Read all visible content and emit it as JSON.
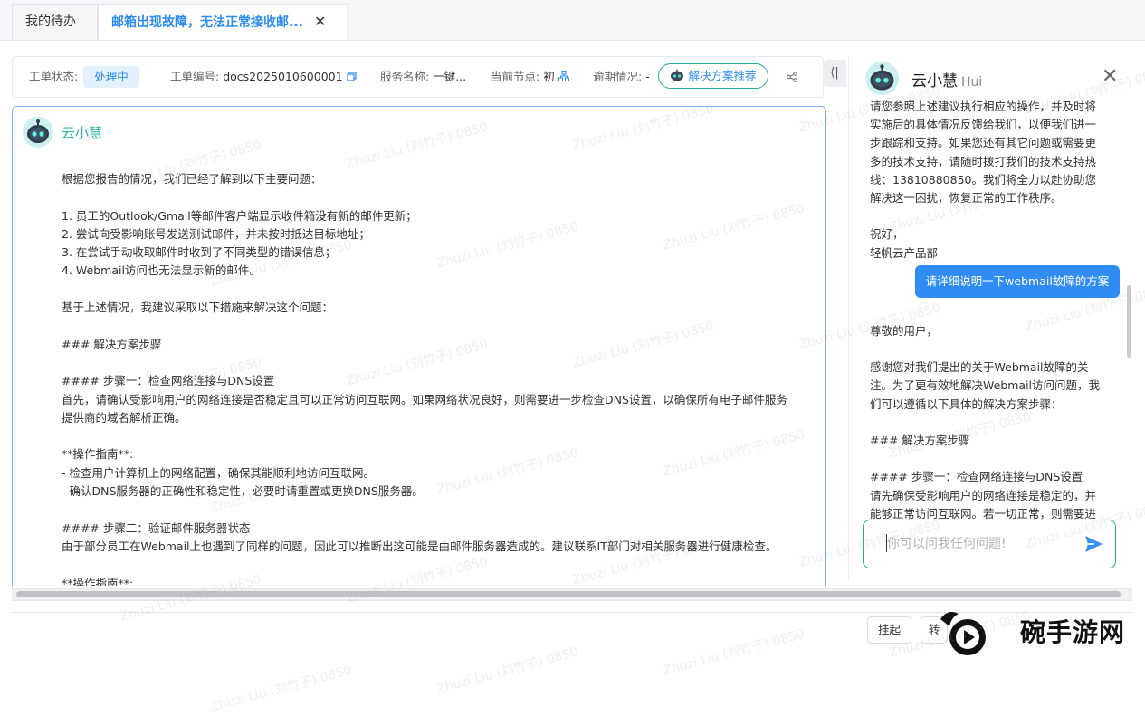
{
  "tabs": [
    {
      "label": "我的待办"
    },
    {
      "label": "邮箱出现故障，无法正常接收邮...",
      "close": "✕"
    }
  ],
  "info": {
    "status_label": "工单状态:",
    "status_value": "处理中",
    "ticket_label": "工单编号:",
    "ticket_value": "docs2025010600001",
    "service_label": "服务名称:",
    "service_value": "一键...",
    "node_label": "当前节点:",
    "node_value": "初",
    "overdue_label": "逾期情况:",
    "overdue_value": "-",
    "recommend_button": "解决方案推荐"
  },
  "collapse_icon": "⟨|",
  "main": {
    "bot_name": "云小慧",
    "message": "根据您报告的情况，我们已经了解到以下主要问题：\n\n1. 员工的Outlook/Gmail等邮件客户端显示收件箱没有新的邮件更新；\n2. 尝试向受影响账号发送测试邮件，并未按时抵达目标地址；\n3. 在尝试手动收取邮件时收到了不同类型的错误信息；\n4. Webmail访问也无法显示新的邮件。\n\n基于上述情况，我建议采取以下措施来解决这个问题：\n\n### 解决方案步骤\n\n#### 步骤一：检查网络连接与DNS设置\n首先，请确认受影响用户的网络连接是否稳定且可以正常访问互联网。如果网络状况良好，则需要进一步检查DNS设置，以确保所有电子邮件服务\n提供商的域名解析正确。\n\n**操作指南**:\n- 检查用户计算机上的网络配置，确保其能顺利地访问互联网。\n- 确认DNS服务器的正确性和稳定性，必要时请重置或更换DNS服务器。\n\n#### 步骤二：验证邮件服务器状态\n由于部分员工在Webmail上也遇到了同样的问题，因此可以推断出这可能是由邮件服务器造成的。建议联系IT部门对相关服务器进行健康检查。\n\n**操作指南**:"
  },
  "side": {
    "title": "云小慧",
    "title_en": "Hui",
    "close": "✕",
    "prev_message": "请您参照上述建议执行相应的操作，并及时将\n实施后的具体情况反馈给我们，以便我们进一\n步跟踪和支持。如果您还有其它问题或需要更\n多的技术支持，请随时拨打我们的技术支持热\n线：13810880850。我们将全力以赴协助您\n解决这一困扰，恢复正常的工作秩序。\n\n祝好，\n轻帆云产品部",
    "user_message": "请详细说明一下webmail故障的方案",
    "reply_message": "尊敬的用户，\n\n感谢您对我们提出的关于Webmail故障的关\n注。为了更有效地解决Webmail访问问题，我\n们可以遵循以下具体的解决方案步骤：\n\n### 解决方案步骤\n\n#### 步骤一：检查网络连接与DNS设置\n请先确保受影响用户的网络连接是稳定的，并\n能够正常访问互联网。若一切正常，则需要进",
    "input_placeholder": "你可以问我任何问题!"
  },
  "footer": {
    "suspend": "挂起",
    "second_button": "转"
  },
  "watermark": {
    "name": "Zhuzi Liu",
    "cn": "(刘竹子)",
    "num": "0850"
  },
  "brand": {
    "site": "碗手游网"
  },
  "colors": {
    "accent": "#2d8cf0",
    "teal": "#2aa7a0",
    "bubble": "#2f8cf5"
  }
}
